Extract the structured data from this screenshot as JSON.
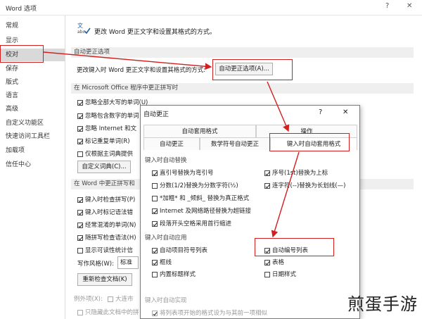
{
  "window": {
    "title": "Word 选项",
    "help": "?",
    "close": "✕"
  },
  "sidebar": {
    "items": [
      {
        "label": "常规"
      },
      {
        "label": "显示"
      },
      {
        "label": "校对"
      },
      {
        "label": "保存"
      },
      {
        "label": "版式"
      },
      {
        "label": "语言"
      },
      {
        "label": "高级"
      },
      {
        "label": "自定义功能区"
      },
      {
        "label": "快速访问工具栏"
      },
      {
        "label": "加载项"
      },
      {
        "label": "信任中心"
      }
    ]
  },
  "main": {
    "header": "更改 Word 更正文字和设置其格式的方式。",
    "autocorrect_section": "自动更正选项",
    "autocorrect_desc": "更改键入时 Word 更正文字和设置其格式的方式:",
    "autocorrect_button": "自动更正选项(A)...",
    "office_section": "在 Microsoft Office 程序中更正拼写时",
    "office_items": [
      {
        "label": "忽略全部大写的单词(U)",
        "checked": true
      },
      {
        "label": "忽略包含数字的单词",
        "checked": true
      },
      {
        "label": "忽略 Internet 和文",
        "checked": true
      },
      {
        "label": "标记重复单词(R)",
        "checked": true
      },
      {
        "label": "仅根据主词典提供",
        "checked": false
      }
    ],
    "custom_dict_button": "自定义词典(C)...",
    "word_section": "在 Word 中更正拼写和",
    "word_items": [
      {
        "label": "键入时检查拼写(P)",
        "checked": true
      },
      {
        "label": "键入时标记语法错",
        "checked": true
      },
      {
        "label": "经常混淆的单词(N)",
        "checked": true
      },
      {
        "label": "随拼写检查语法(H)",
        "checked": true
      },
      {
        "label": "显示可读性统计信",
        "checked": false
      }
    ],
    "writing_style_label": "写作风格(W):",
    "writing_style_value": "标准",
    "recheck_button": "重新检查文档(K)",
    "exceptions_label": "例外项(X):",
    "exceptions_value": "大连市",
    "hide_errors_label": "只隐藏此文档中的拼"
  },
  "dialog": {
    "title": "自动更正",
    "help": "?",
    "close": "✕",
    "tabs_top": [
      "自动套用格式",
      "操作"
    ],
    "tabs_bottom": [
      "自动更正",
      "数学符号自动更正",
      "键入时自动套用格式"
    ],
    "replace_section": "键入时自动替换",
    "replace_left": [
      {
        "label": "直引号替换为弯引号",
        "checked": true
      },
      {
        "label": "分数(1/2)替换为分数字符(½)",
        "checked": false
      },
      {
        "label": "*加粗* 和 _倾斜_ 替换为真正格式",
        "checked": false
      },
      {
        "label": "Internet 及网络路径替换为超链接",
        "checked": true
      },
      {
        "label": "段落开头空格采用首行缩进",
        "checked": true
      }
    ],
    "replace_right": [
      {
        "label": "序号(1st)替换为上标",
        "checked": true
      },
      {
        "label": "连字符(--)替换为长划线(—)",
        "checked": true
      }
    ],
    "apply_section": "键入时自动应用",
    "apply_left": [
      {
        "label": "自动项目符号列表",
        "checked": true
      },
      {
        "label": "框线",
        "checked": true
      },
      {
        "label": "内置标题样式",
        "checked": false
      }
    ],
    "apply_right": [
      {
        "label": "自动编号列表",
        "checked": true
      },
      {
        "label": "表格",
        "checked": true
      },
      {
        "label": "日期样式",
        "checked": false
      }
    ],
    "implement_section": "键入时自动实现",
    "implement_item": {
      "label": "将列表项开始的格式设为与其前一项相似",
      "checked": true
    }
  },
  "watermark": "煎蛋手游",
  "colors": {
    "highlight": "#d22020",
    "selected_side": "#d9d9d9",
    "section_bg": "#efefef"
  }
}
